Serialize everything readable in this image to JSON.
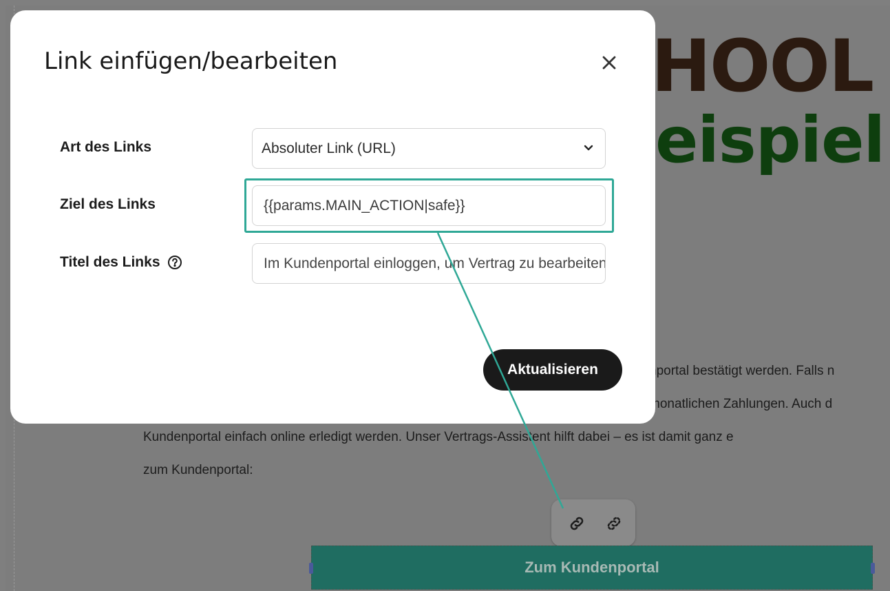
{
  "background": {
    "hero_line1": "HOOL",
    "hero_line2": "eispiel",
    "paragraph_lines": [
      "nportal bestätigt werden. Falls n",
      "monatlichen Zahlungen. Auch d",
      "Kundenportal einfach online erledigt werden. Unser Vertrags-Assistent hilft dabei – es ist damit ganz e",
      "zum Kundenportal:"
    ],
    "cta_label": "Zum Kundenportal",
    "toolbar": {
      "link_icon": "link-icon",
      "unlink_icon": "unlink-icon"
    }
  },
  "modal": {
    "title": "Link einfügen/bearbeiten",
    "close_icon": "close-icon",
    "fields": {
      "type": {
        "label": "Art des Links",
        "value": "Absoluter Link (URL)"
      },
      "target": {
        "label": "Ziel des Links",
        "value": "{{params.MAIN_ACTION|safe}}"
      },
      "title": {
        "label": "Titel des Links",
        "value": "Im Kundenportal einloggen, um Vertrag zu bearbeiten",
        "help_icon": "help-icon"
      }
    },
    "update_label": "Aktualisieren"
  },
  "colors": {
    "highlight": "#2fa896",
    "cta": "#1f6d61",
    "overlay": "#7d7d7d"
  }
}
